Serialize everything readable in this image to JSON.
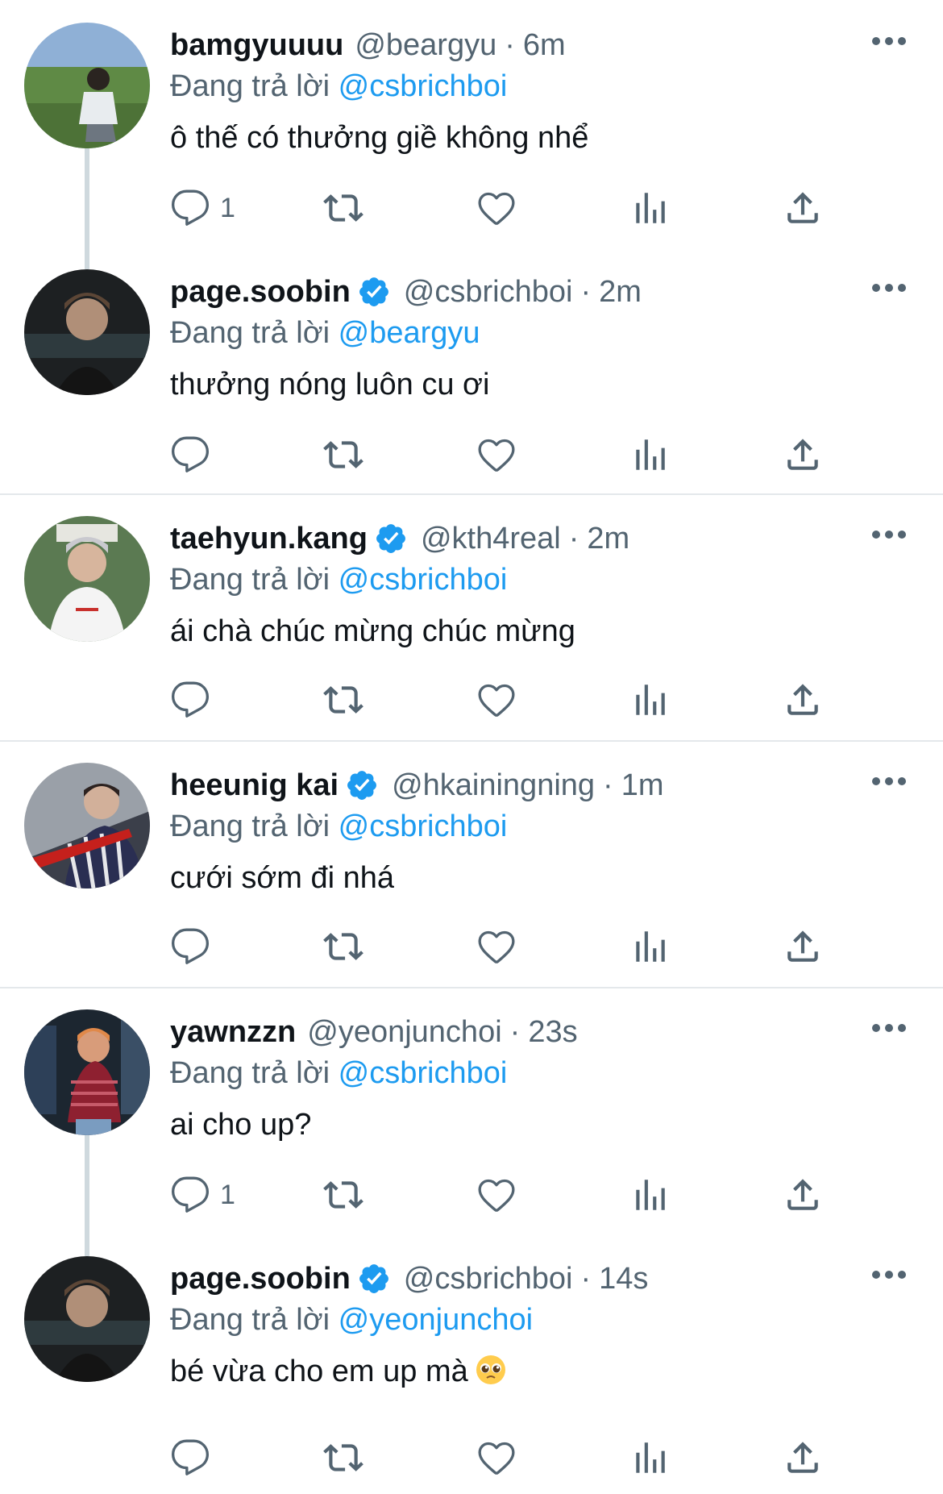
{
  "reply_prefix": "Đang trả lời",
  "colors": {
    "link": "#1d9bf0",
    "secondary": "#536471",
    "text": "#0f1419",
    "verified": "#1d9bf0",
    "separator": "#e4e8eb"
  },
  "icons": {
    "reply": "reply-icon",
    "retweet": "retweet-icon",
    "like": "heart-icon",
    "views": "views-icon",
    "share": "share-icon",
    "more": "more-icon",
    "verified": "verified-badge-icon"
  },
  "tweets": [
    {
      "name": "bamgyuuuu",
      "handle": "@beargyu",
      "time": "6m",
      "reply_to": "@csbrichboi",
      "text": "ô thế có thưởng giề không nhể",
      "reply_count": "1",
      "verified": false
    },
    {
      "name": "page.soobin",
      "handle": "@csbrichboi",
      "time": "2m",
      "reply_to": "@beargyu",
      "text": "thưởng nóng luôn cu ơi",
      "reply_count": "",
      "verified": true
    },
    {
      "name": "taehyun.kang",
      "handle": "@kth4real",
      "time": "2m",
      "reply_to": "@csbrichboi",
      "text": "ái chà chúc mừng chúc mừng",
      "reply_count": "",
      "verified": true
    },
    {
      "name": "heeunig kai",
      "handle": "@hkainingning",
      "time": "1m",
      "reply_to": "@csbrichboi",
      "text": "cưới sớm đi nhá",
      "reply_count": "",
      "verified": true
    },
    {
      "name": "yawnzzn",
      "handle": "@yeonjunchoi",
      "time": "23s",
      "reply_to": "@csbrichboi",
      "text": "ai cho up?",
      "reply_count": "1",
      "verified": false
    },
    {
      "name": "page.soobin",
      "handle": "@csbrichboi",
      "time": "14s",
      "reply_to": "@yeonjunchoi",
      "text": "bé vừa cho em up mà",
      "reply_count": "",
      "verified": true,
      "emoji": "pleading-face-emoji"
    }
  ]
}
